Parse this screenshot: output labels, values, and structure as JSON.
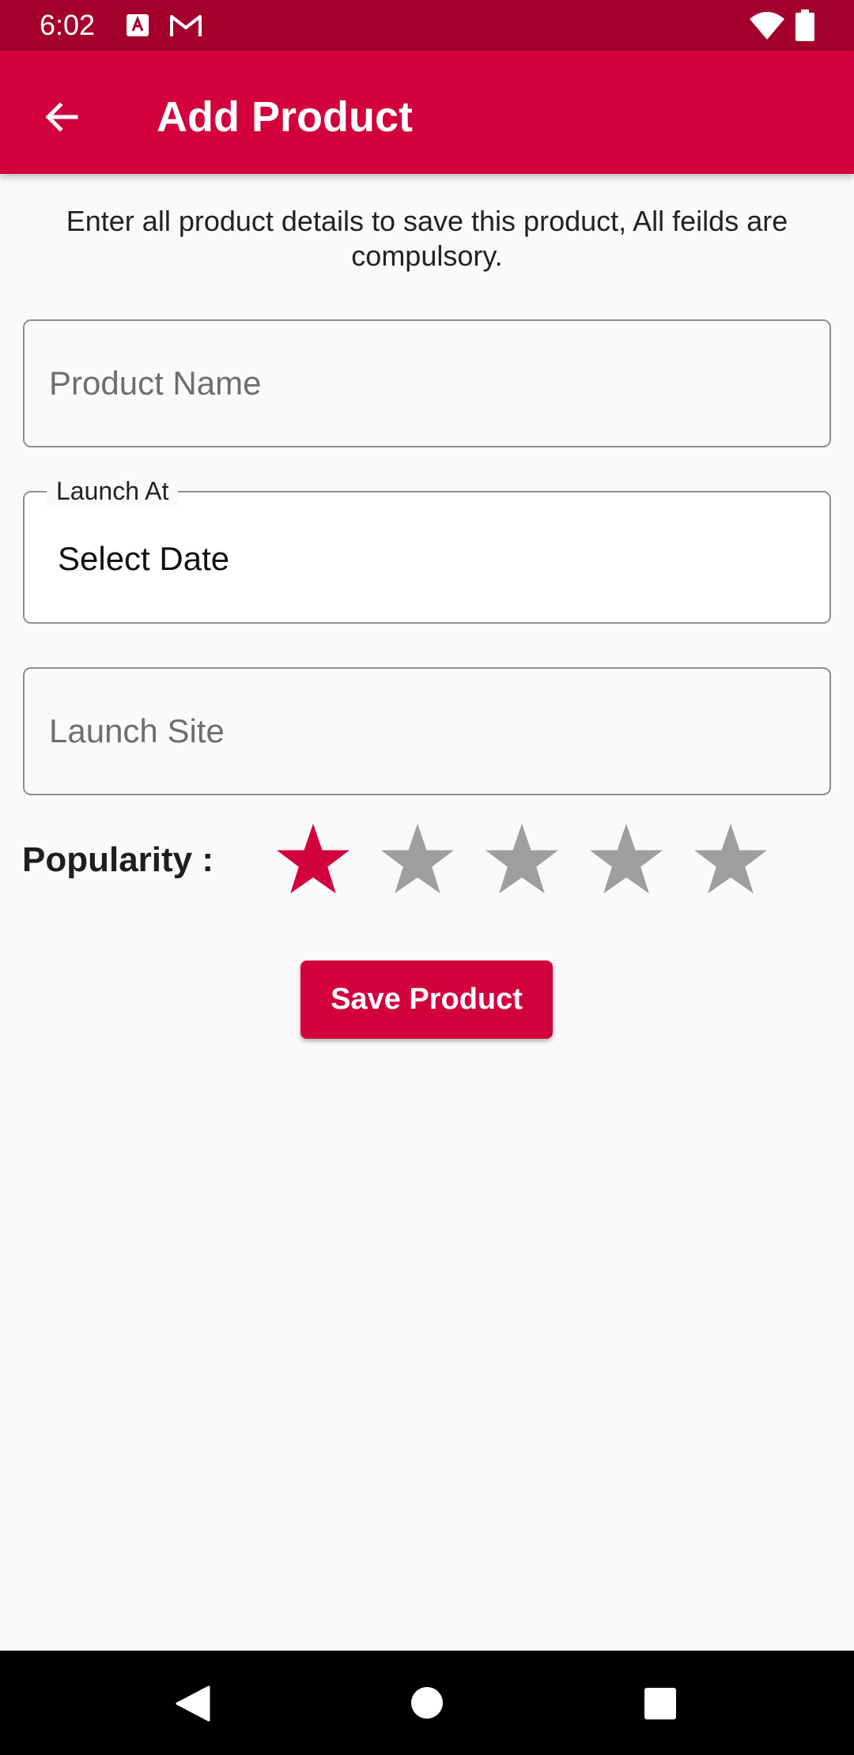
{
  "status_bar": {
    "time": "6:02",
    "icons": [
      "a-notification-icon",
      "gmail-icon",
      "wifi-icon",
      "battery-icon"
    ]
  },
  "app_bar": {
    "title": "Add Product",
    "back_icon": "arrow-left-icon",
    "background_color": "#d2003c"
  },
  "instructions": "Enter all product details to save this product, All feilds are compulsory.",
  "form": {
    "product_name": {
      "placeholder": "Product Name",
      "value": ""
    },
    "launch_at": {
      "label": "Launch At",
      "value": "Select Date"
    },
    "launch_site": {
      "placeholder": "Launch Site",
      "value": ""
    }
  },
  "popularity": {
    "label": "Popularity :",
    "rating": 1,
    "max": 5,
    "active_color": "#d2003c",
    "inactive_color": "#9e9e9e"
  },
  "save_button": {
    "label": "Save Product"
  },
  "nav_bar": {
    "icons": [
      "back-triangle-icon",
      "home-circle-icon",
      "recents-square-icon"
    ]
  }
}
